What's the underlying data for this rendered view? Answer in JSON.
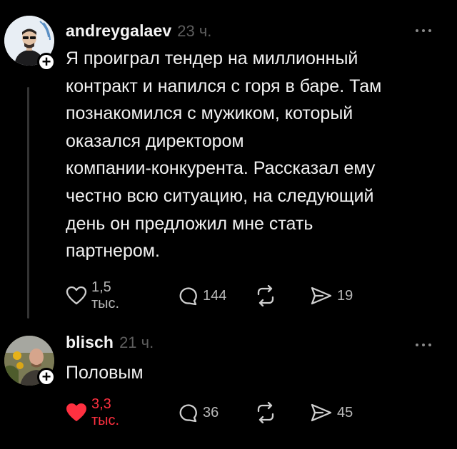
{
  "posts": [
    {
      "username": "andreygalaev",
      "time": "23 ч.",
      "text": "Я проиграл тендер на миллионный\nконтракт и напился с горя в баре. Там\nпознакомился с мужиком, который\nоказался директором\nкомпании-конкурента. Рассказал ему\nчестно всю ситуацию, на следующий\nдень он предложил мне стать\nпартнером.",
      "likes": "1,5 тыс.",
      "comments": "144",
      "reposts": "",
      "shares": "19",
      "liked": false
    },
    {
      "username": "blisch",
      "time": "21 ч.",
      "text": "Половым",
      "likes": "3,3 тыс.",
      "comments": "36",
      "reposts": "",
      "shares": "45",
      "liked": true
    }
  ],
  "colors": {
    "background": "#000000",
    "like_active": "#ff3040",
    "muted": "#5e5e5e"
  },
  "icons": [
    "heart-icon",
    "comment-icon",
    "repost-icon",
    "share-icon",
    "more-icon",
    "plus-icon"
  ]
}
